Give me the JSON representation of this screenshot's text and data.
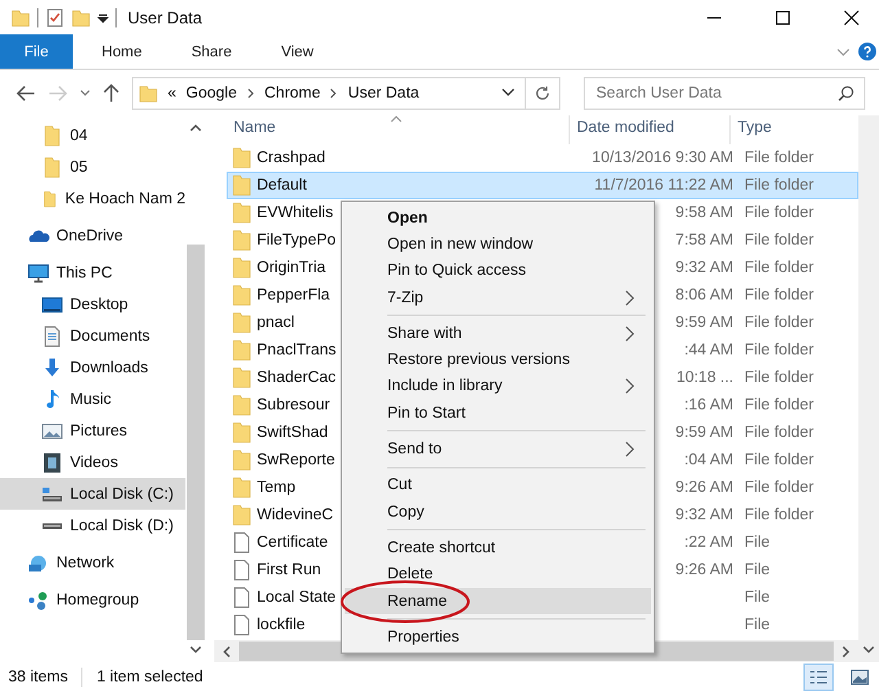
{
  "window": {
    "title": "User Data"
  },
  "ribbon": {
    "tabs": [
      {
        "label": "File",
        "kind": "file",
        "selected": false
      },
      {
        "label": "Home",
        "kind": "tab",
        "selected": false
      },
      {
        "label": "Share",
        "kind": "tab",
        "selected": false
      },
      {
        "label": "View",
        "kind": "tab",
        "selected": false
      }
    ]
  },
  "address": {
    "overflow": "«",
    "crumbs": [
      "Google",
      "Chrome",
      "User Data"
    ]
  },
  "search": {
    "placeholder": "Search User Data"
  },
  "nav": {
    "items": [
      {
        "label": "04",
        "kind": "folder",
        "selected": false
      },
      {
        "label": "05",
        "kind": "folder",
        "selected": false
      },
      {
        "label": "Ke Hoach Nam 2",
        "kind": "folder",
        "selected": false
      },
      {
        "label": "OneDrive",
        "kind": "cloud",
        "selected": false
      },
      {
        "label": "This PC",
        "kind": "computer",
        "selected": false,
        "children": [
          {
            "label": "Desktop",
            "kind": "desktop",
            "selected": false
          },
          {
            "label": "Documents",
            "kind": "documents",
            "selected": false
          },
          {
            "label": "Downloads",
            "kind": "download",
            "selected": false
          },
          {
            "label": "Music",
            "kind": "music",
            "selected": false
          },
          {
            "label": "Pictures",
            "kind": "pictures",
            "selected": false
          },
          {
            "label": "Videos",
            "kind": "videos",
            "selected": false
          },
          {
            "label": "Local Disk (C:)",
            "kind": "drive",
            "selected": true
          },
          {
            "label": "Local Disk (D:)",
            "kind": "drive",
            "selected": false
          }
        ]
      },
      {
        "label": "Network",
        "kind": "network",
        "selected": false
      },
      {
        "label": "Homegroup",
        "kind": "homegroup",
        "selected": false
      }
    ]
  },
  "table": {
    "columns": [
      "Name",
      "Date modified",
      "Type"
    ],
    "rows": [
      {
        "name": "Crashpad",
        "date": "10/13/2016 9:30 AM",
        "type": "File folder",
        "kind": "folder",
        "selected": false
      },
      {
        "name": "Default",
        "date": "11/7/2016 11:22 AM",
        "type": "File folder",
        "kind": "folder",
        "selected": true
      },
      {
        "name": "EVWhitelis",
        "date": "9:58 AM",
        "type": "File folder",
        "kind": "folder",
        "selected": false
      },
      {
        "name": "FileTypePo",
        "date": "7:58 AM",
        "type": "File folder",
        "kind": "folder",
        "selected": false
      },
      {
        "name": "OriginTria",
        "date": "9:32 AM",
        "type": "File folder",
        "kind": "folder",
        "selected": false
      },
      {
        "name": "PepperFla",
        "date": "8:06 AM",
        "type": "File folder",
        "kind": "folder",
        "selected": false
      },
      {
        "name": "pnacl",
        "date": "9:59 AM",
        "type": "File folder",
        "kind": "folder",
        "selected": false
      },
      {
        "name": "PnaclTrans",
        "date": ":44 AM",
        "type": "File folder",
        "kind": "folder",
        "selected": false
      },
      {
        "name": "ShaderCac",
        "date": "10:18 ...",
        "type": "File folder",
        "kind": "folder",
        "selected": false
      },
      {
        "name": "Subresour",
        "date": ":16 AM",
        "type": "File folder",
        "kind": "folder",
        "selected": false
      },
      {
        "name": "SwiftShad",
        "date": "9:59 AM",
        "type": "File folder",
        "kind": "folder",
        "selected": false
      },
      {
        "name": "SwReporte",
        "date": ":04 AM",
        "type": "File folder",
        "kind": "folder",
        "selected": false
      },
      {
        "name": "Temp",
        "date": "9:26 AM",
        "type": "File folder",
        "kind": "folder",
        "selected": false
      },
      {
        "name": "WidevineC",
        "date": "9:32 AM",
        "type": "File folder",
        "kind": "folder",
        "selected": false
      },
      {
        "name": "Certificate",
        "date": ":22 AM",
        "type": "File",
        "kind": "file",
        "selected": false
      },
      {
        "name": "First Run",
        "date": "9:26 AM",
        "type": "File",
        "kind": "file",
        "selected": false
      },
      {
        "name": "Local State",
        "type": "File",
        "kind": "file",
        "selected": false
      },
      {
        "name": "lockfile",
        "type": "File",
        "kind": "file",
        "selected": false
      }
    ]
  },
  "context_menu": {
    "items": [
      {
        "label": "Open",
        "kind": "default",
        "highlighted": false
      },
      {
        "label": "Open in new window",
        "kind": "item",
        "highlighted": false
      },
      {
        "label": "Pin to Quick access",
        "kind": "item",
        "highlighted": false
      },
      {
        "label": "7-Zip",
        "kind": "submenu",
        "highlighted": false
      },
      {
        "kind": "separator"
      },
      {
        "label": "Share with",
        "kind": "submenu",
        "highlighted": false
      },
      {
        "label": "Restore previous versions",
        "kind": "item",
        "highlighted": false
      },
      {
        "label": "Include in library",
        "kind": "submenu",
        "highlighted": false
      },
      {
        "label": "Pin to Start",
        "kind": "item",
        "highlighted": false
      },
      {
        "kind": "separator"
      },
      {
        "label": "Send to",
        "kind": "submenu",
        "highlighted": false
      },
      {
        "kind": "separator"
      },
      {
        "label": "Cut",
        "kind": "item",
        "highlighted": false
      },
      {
        "label": "Copy",
        "kind": "item",
        "highlighted": false
      },
      {
        "kind": "separator"
      },
      {
        "label": "Create shortcut",
        "kind": "item",
        "highlighted": false
      },
      {
        "label": "Delete",
        "kind": "item",
        "highlighted": false
      },
      {
        "label": "Rename",
        "kind": "item",
        "highlighted": true,
        "circled": true
      },
      {
        "kind": "separator"
      },
      {
        "label": "Properties",
        "kind": "item",
        "highlighted": false
      }
    ]
  },
  "status_bar": {
    "count": "38 items",
    "selection": "1 item selected"
  }
}
